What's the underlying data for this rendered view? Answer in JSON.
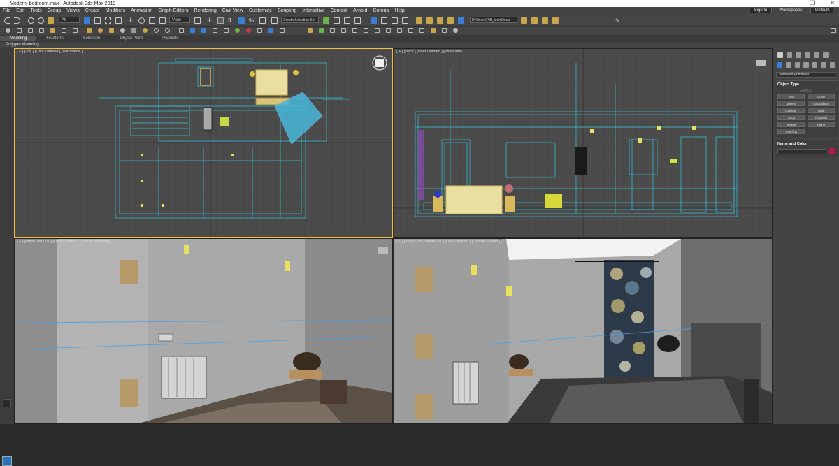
{
  "window": {
    "title": "Modern_bedroom.max - Autodesk 3ds Max 2019",
    "controls": [
      "—",
      "❐",
      "✕"
    ]
  },
  "menu": [
    "File",
    "Edit",
    "Tools",
    "Group",
    "Views",
    "Create",
    "Modifiers",
    "Animation",
    "Graph Editors",
    "Rendering",
    "Civil View",
    "Customize",
    "Scripting",
    "Interactive",
    "Content",
    "Arnold",
    "Corona",
    "Help"
  ],
  "account": {
    "sign_in": "Sign In",
    "workspaces_label": "Workspaces:",
    "workspace_value": "Default"
  },
  "toolbar": {
    "filter_value": "All",
    "view_value": "View",
    "selection_set_placeholder": "Create Selection Set",
    "path_value": "D:\\Users\\Pdf_arch\\Docu"
  },
  "ribbon": {
    "tabs": [
      "Modeling",
      "Freeform",
      "Selection",
      "Object Paint",
      "Populate"
    ],
    "active_tab": "Modeling",
    "sub": "Polygon Modeling"
  },
  "viewports": {
    "top": "[ + ] [Top ] [User Defined ] [Wireframe ]",
    "back": "[ + ] [Back ] [User Defined ] [Wireframe ]",
    "persp": "[ + ] [PhysCam 001 ] [User Defined ] [Default Shading ]",
    "cam": "[ + ] [PhysCamCamera001 ] [User Defined ] [Default Shading ]"
  },
  "command_panel": {
    "category": "Standard Primitives",
    "object_type_header": "Object Type",
    "autogrid": "AutoGrid",
    "primitives": [
      "Box",
      "Cone",
      "Sphere",
      "GeoSphere",
      "Cylinder",
      "Tube",
      "Torus",
      "Pyramid",
      "Teapot",
      "Plane",
      "TextPlus"
    ],
    "name_color_header": "Name and Color",
    "object_color": "#b5154a"
  },
  "colors": {
    "wire": "#33c7e0",
    "grid": "#5a5a5a",
    "selected": "#e8e060"
  }
}
